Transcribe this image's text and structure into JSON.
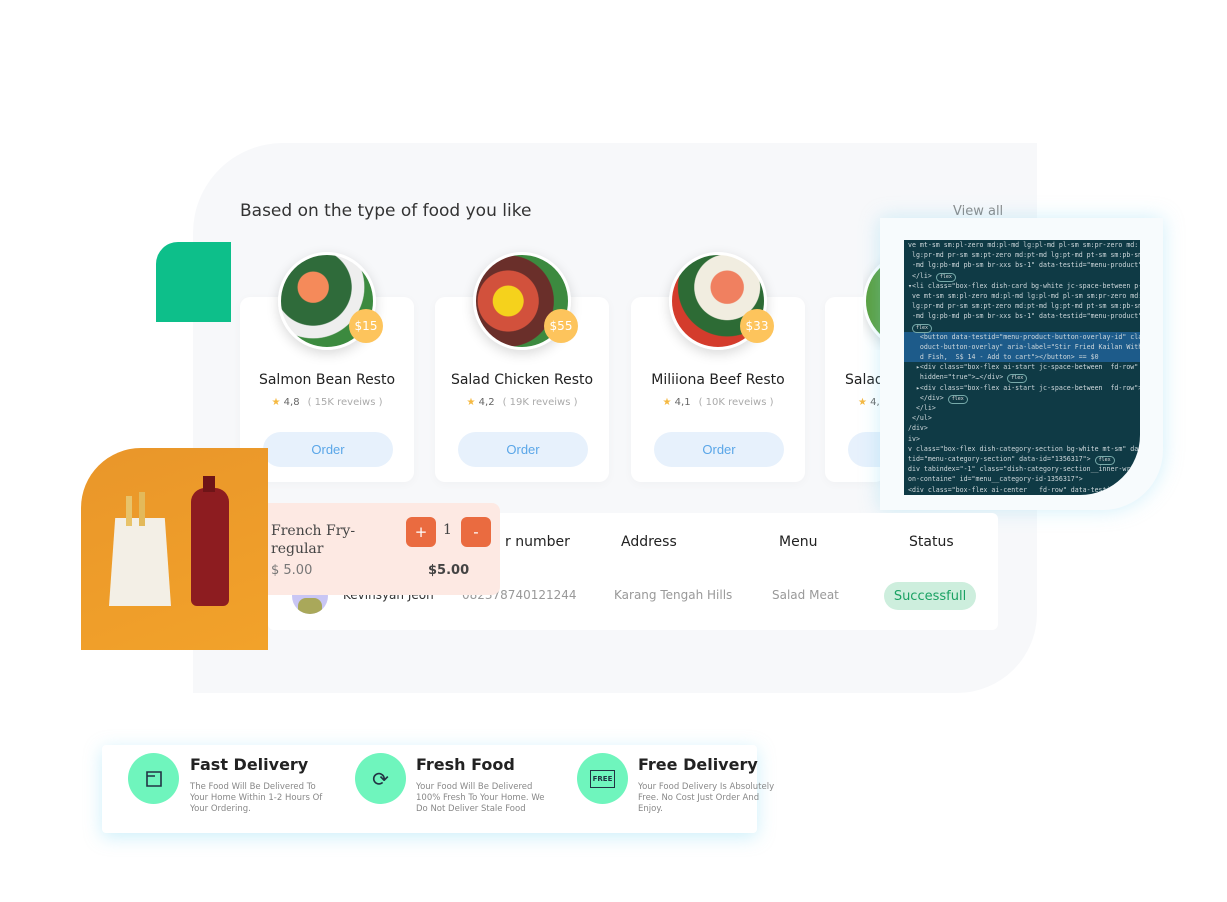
{
  "section": {
    "title": "Based on the type of food you like",
    "view_all": "View all"
  },
  "cards": [
    {
      "name": "Salmon Bean Resto",
      "price": "$15",
      "rating": "4,8",
      "reviews": "( 15K reveiws )",
      "order": "Order"
    },
    {
      "name": "Salad Chicken Resto",
      "price": "$55",
      "rating": "4,2",
      "reviews": "( 19K reveiws )",
      "order": "Order"
    },
    {
      "name": "Miliiona Beef Resto",
      "price": "$33",
      "rating": "4,1",
      "reviews": "( 10K reveiws )",
      "order": "Order"
    },
    {
      "name": "Salad",
      "price": "",
      "rating": "4,",
      "reviews": "",
      "order": "Order"
    }
  ],
  "code_lines": [
    "ve mt-sm sm:pl-zero md:pl-md lg:pl-md pl-sm sm:pr-zero md:",
    " lg:pr-md pr-sm sm:pt-zero md:pt-md lg:pt-md pt-sm sm:pb-sm",
    " -md lg:pb-md pb-sm br-xxs bs-1\" data-testid=\"menu-product\"",
    " </li>",
    "▾<li class=\"box-flex dish-card bg-white jc-space-between p-",
    " ve mt-sm sm:pl-zero md:pl-md lg:pl-md pl-sm sm:pr-zero md:",
    " lg:pr-md pr-sm sm:pt-zero md:pt-md lg:pt-md pt-sm sm:pb-sm",
    " -md lg:pb-md pb-sm br-xxs bs-1\" data-testid=\"menu-product\"",
    "",
    "   <button data-testid=\"menu-product-button-overlay-id\" cla",
    "   oduct-button-overlay\" aria-label=\"Stir Fried Kailan With",
    "   d Fish,  S$ 14 - Add to cart\"></button> == $0",
    "  ▸<div class=\"box-flex ai-start jc-space-between  fd-row\"",
    "   hidden=\"true\">…</div>",
    "  ▸<div class=\"box-flex ai-start jc-space-between  fd-row\">",
    "   </div>",
    "  </li>",
    " </ul>",
    "/div>",
    "iv>",
    "v class=\"box-flex dish-category-section bg-white mt-sm\" data",
    "tid=\"menu-category-section\" data-id=\"1356317\">",
    "div tabindex=\"-1\" class=\"dish-category-section__inner-wrap",
    "on-containe\" id=\"menu__category-id-1356317\">",
    "<div class=\"box-flex ai-center   fd-row\" data-testid",
    "v-section-title\">…</div>"
  ],
  "flex_badge": "flex",
  "table": {
    "headers": [
      "r number",
      "Address",
      "Menu",
      "Status"
    ],
    "row": {
      "name": "Kevinsyah Jeon",
      "phone": "082378740121244",
      "address": "Karang Tengah Hills",
      "menu": "Salad Meat",
      "status": "Successfull"
    }
  },
  "cart_item": {
    "name": "French Fry-regular",
    "plus": "+",
    "qty": "1",
    "minus": "-",
    "unit_price": "$ 5.00",
    "total": "$5.00"
  },
  "features": [
    {
      "title": "Fast Delivery",
      "desc": "The Food Will Be Delivered To Your Home Within 1-2 Hours Of Your Ordering.",
      "icon": "box-icon"
    },
    {
      "title": "Fresh Food",
      "desc": "Your Food Will Be Delivered 100% Fresh To Your Home. We Do Not Deliver Stale Food",
      "icon": "refresh-icon"
    },
    {
      "title": "Free Delivery",
      "desc": "Your Food Delivery Is Absolutely Free. No Cost Just Order And Enjoy.",
      "icon": "free-icon",
      "icon_text": "FREE"
    }
  ],
  "colors": {
    "accent_green": "#0dbf8a",
    "price_badge": "#fdc45c",
    "qty_button": "#ea6b40",
    "feature_icon_bg": "#6ff5bd",
    "status_bg": "#cdeedd"
  }
}
